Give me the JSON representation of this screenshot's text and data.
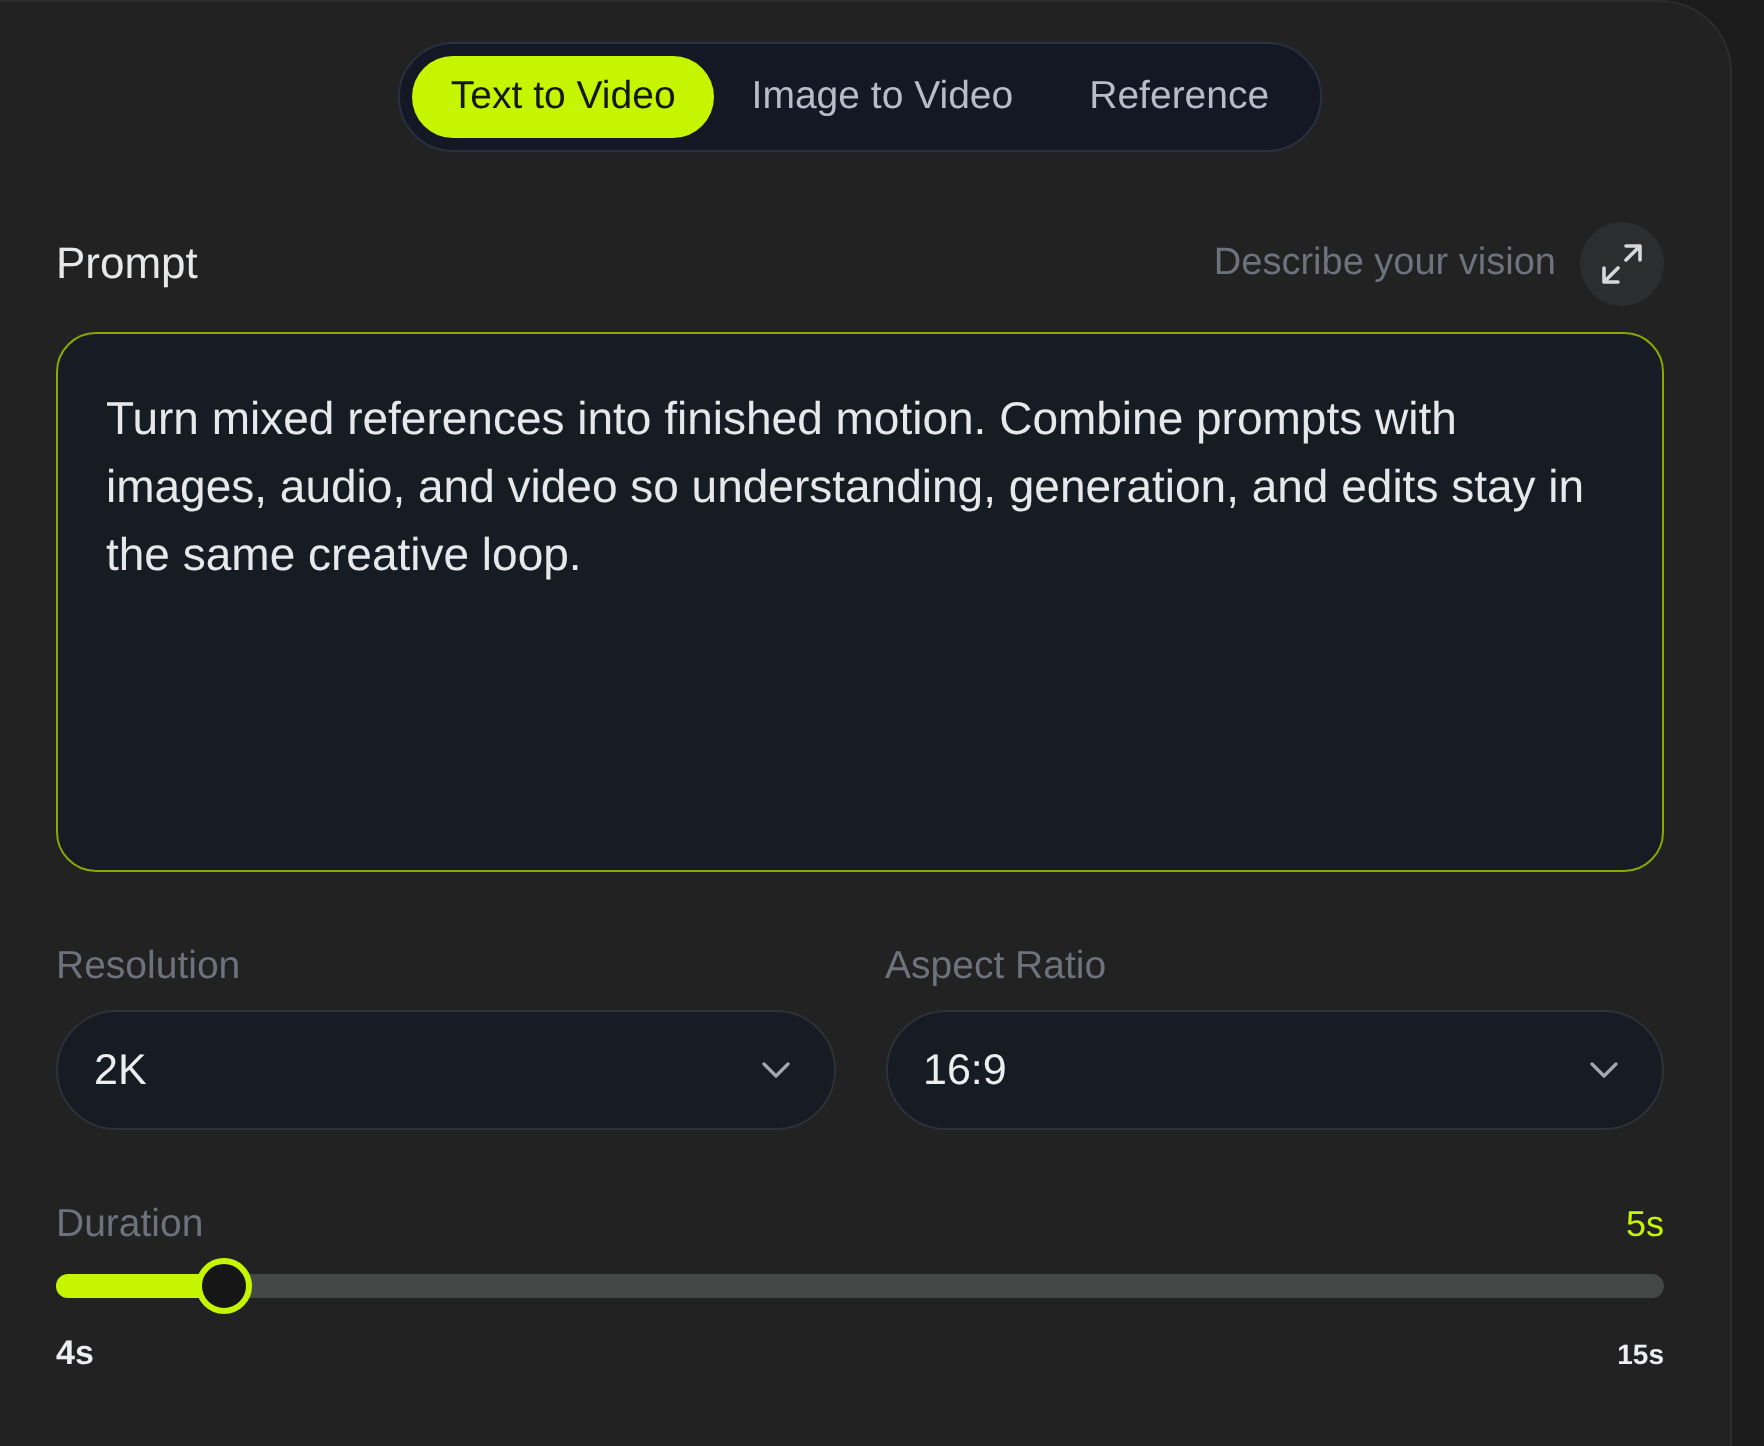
{
  "tabs": [
    {
      "label": "Text to Video",
      "selected": true
    },
    {
      "label": "Image to Video",
      "selected": false
    },
    {
      "label": "Reference",
      "selected": false
    }
  ],
  "prompt": {
    "label": "Prompt",
    "hint": "Describe your vision",
    "value": "Turn mixed references into finished motion. Combine prompts with images, audio, and video so understanding, generation, and edits stay in the same creative loop.",
    "focused": true
  },
  "selects": [
    {
      "label": "Resolution",
      "value": "2K"
    },
    {
      "label": "Aspect Ratio",
      "value": "16:9"
    }
  ],
  "duration": {
    "label": "Duration",
    "reading": "5s",
    "level": 0.09,
    "min_label": "4s",
    "max_label": "15s"
  }
}
